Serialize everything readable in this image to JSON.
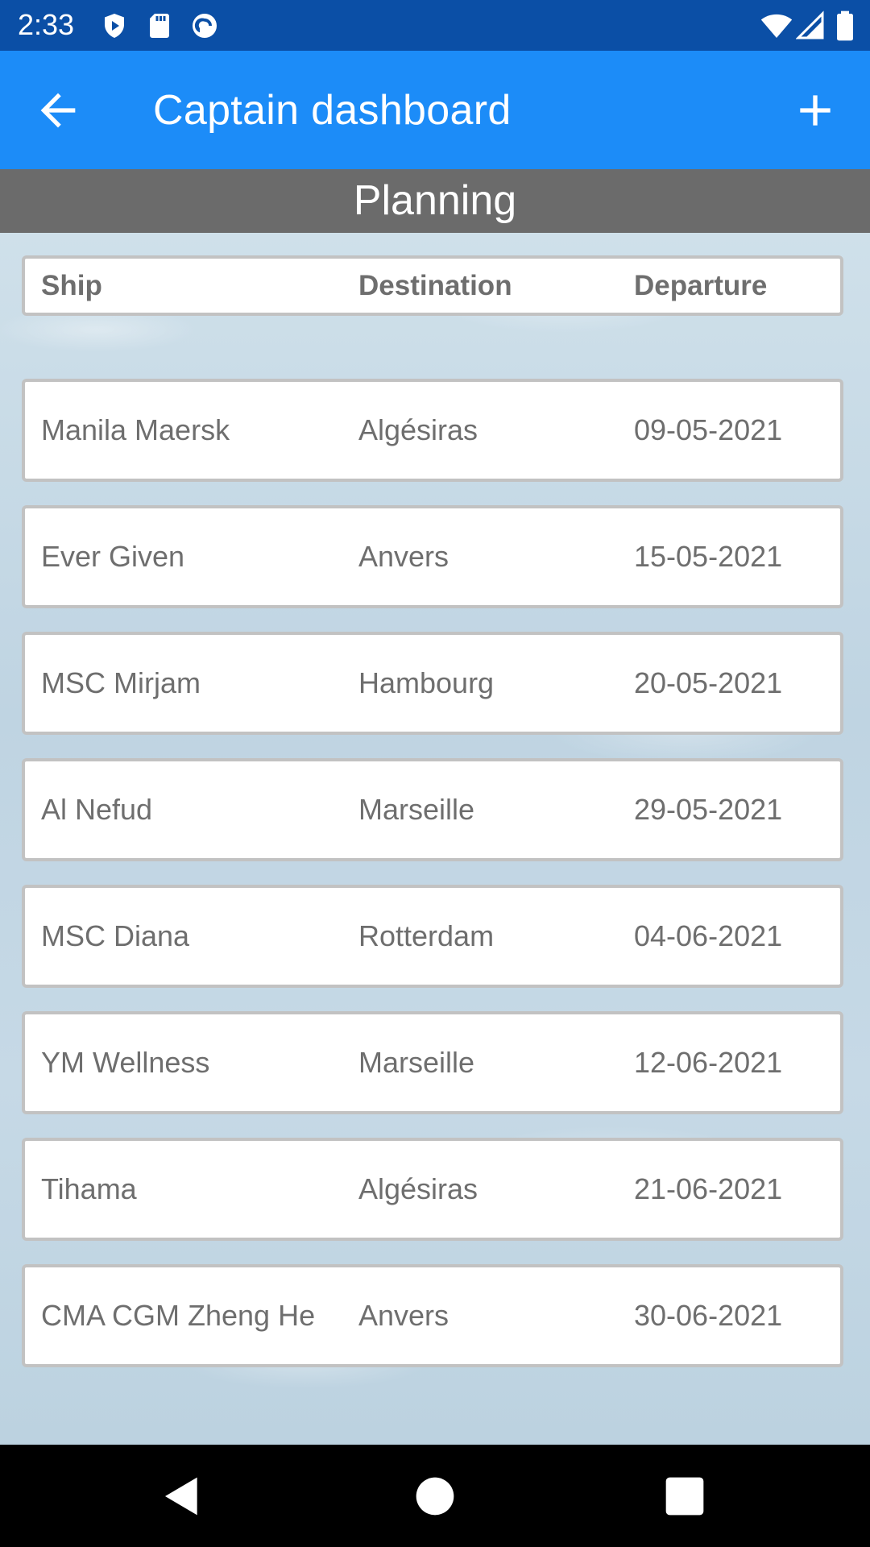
{
  "status_bar": {
    "time": "2:33",
    "icons": [
      "play-protect-icon",
      "sd-card-icon",
      "pocket-casts-icon",
      "wifi-icon",
      "signal-icon",
      "battery-icon"
    ]
  },
  "app_bar": {
    "title": "Captain dashboard",
    "back_icon": "arrow-back-icon",
    "add_icon": "plus-icon",
    "color": "#1c8cf8"
  },
  "section": {
    "title": "Planning"
  },
  "table": {
    "columns": [
      "Ship",
      "Destination",
      "Departure"
    ],
    "rows": [
      {
        "ship": "Manila Maersk",
        "destination": "Algésiras",
        "departure": "09-05-2021"
      },
      {
        "ship": "Ever Given",
        "destination": "Anvers",
        "departure": "15-05-2021"
      },
      {
        "ship": "MSC Mirjam",
        "destination": "Hambourg",
        "departure": "20-05-2021"
      },
      {
        "ship": "Al Nefud",
        "destination": "Marseille",
        "departure": "29-05-2021"
      },
      {
        "ship": "MSC Diana",
        "destination": "Rotterdam",
        "departure": "04-06-2021"
      },
      {
        "ship": "YM Wellness",
        "destination": "Marseille",
        "departure": "12-06-2021"
      },
      {
        "ship": "Tihama",
        "destination": "Algésiras",
        "departure": "21-06-2021"
      },
      {
        "ship": "CMA CGM Zheng He",
        "destination": "Anvers",
        "departure": "30-06-2021"
      }
    ]
  },
  "nav_bar": {
    "icons": [
      "back-triangle-icon",
      "home-circle-icon",
      "recents-square-icon"
    ]
  }
}
